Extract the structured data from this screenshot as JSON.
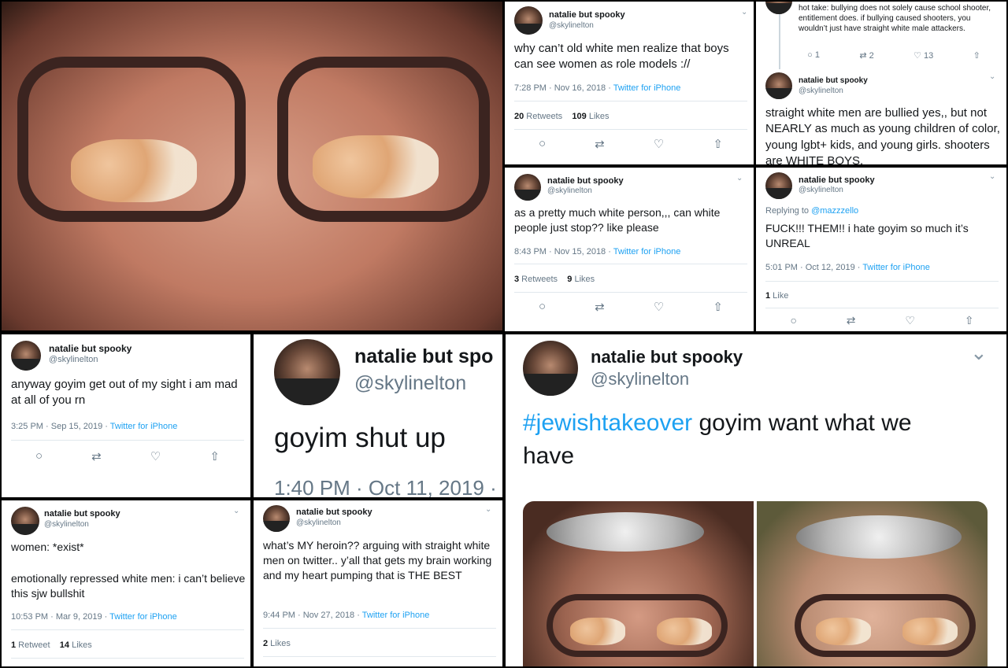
{
  "user": {
    "name": "natalie but spooky",
    "handle": "@skylinelton",
    "name_cut": "natalie but spo"
  },
  "tweets": {
    "t1": {
      "text": "why can’t old white men realize that boys can see women as role models ://",
      "time": "7:28 PM · Nov 16, 2018 · ",
      "source": "Twitter for iPhone",
      "rt_count": "20",
      "rt_label": " Retweets",
      "like_count": "109",
      "like_label": " Likes"
    },
    "t2": {
      "text_top": "hot take: bullying does not solely cause school shooter, entitlement does. if bullying caused shooters, you wouldn’t just have straight white male attackers.",
      "reply": "1",
      "retweet": "2",
      "like": "13",
      "text": "straight white men are bullied yes,, but not NEARLY as much as young children of color, young lgbt+ kids, and young girls. shooters are WHITE BOYS."
    },
    "t3": {
      "text": "as a pretty much white person,,, can white people just stop?? like please",
      "time": "8:43 PM · Nov 15, 2018 · ",
      "source": "Twitter for iPhone",
      "rt_count": "3",
      "rt_label": " Retweets",
      "like_count": "9",
      "like_label": " Likes"
    },
    "t4": {
      "replying": "Replying to ",
      "replying_to": "@mazzzello",
      "text": "FUCK!!! THEM!! i hate goyim so much it’s UNREAL",
      "time": "5:01 PM · Oct 12, 2019 · ",
      "source": "Twitter for iPhone",
      "like_count": "1",
      "like_label": " Like"
    },
    "t5": {
      "text": "anyway goyim get out of my sight i am mad at all of you rn",
      "time": "3:25 PM · Sep 15, 2019 · ",
      "source": "Twitter for iPhone"
    },
    "t6": {
      "text": "goyim shut up",
      "time": "1:40 PM · Oct 11, 2019 ·"
    },
    "t7": {
      "hashtag": "#jewishtakeover",
      "text": " goyim want what we have"
    },
    "t8": {
      "text1": "women: *exist*",
      "text2": "emotionally repressed white men: i can’t believe this sjw bullshit",
      "time": "10:53 PM · Mar 9, 2019 · ",
      "source": "Twitter for iPhone",
      "rt_count": "1",
      "rt_label": " Retweet",
      "like_count": "14",
      "like_label": " Likes"
    },
    "t9": {
      "text": "what’s MY heroin?? arguing with straight white men on twitter.. y’all that gets my brain working and my heart pumping that is THE BEST",
      "time": "9:44 PM · Nov 27, 2018 · ",
      "source": "Twitter for iPhone",
      "like_count": "2",
      "like_label": " Likes"
    }
  },
  "icons": [
    "reply-icon",
    "retweet-icon",
    "like-icon",
    "share-icon",
    "chevron-down-icon"
  ],
  "colors": {
    "link": "#1da1f2",
    "muted": "#657786",
    "bg": "#000000"
  }
}
